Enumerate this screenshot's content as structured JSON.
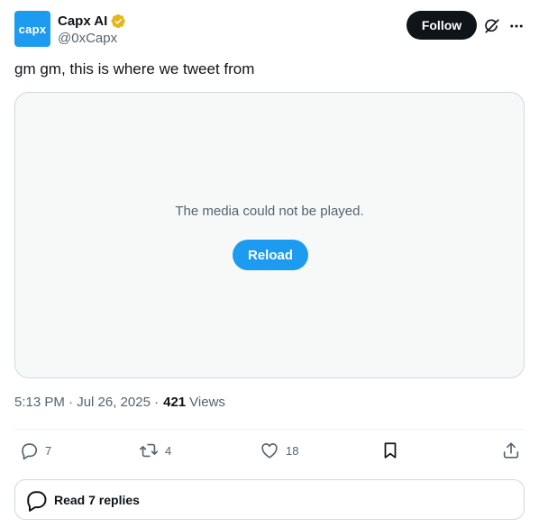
{
  "author": {
    "avatar_text": "capx",
    "display_name": "Capx AI",
    "handle": "@0xCapx",
    "verified": true,
    "brand_color": "#1d9bf0",
    "badge_color": "#e2b719"
  },
  "header": {
    "follow_label": "Follow",
    "grok_icon": "grok-icon",
    "more_icon": "more-icon"
  },
  "tweet": {
    "text": "gm gm, this is where we tweet from"
  },
  "media": {
    "message": "The media could not be played.",
    "reload_label": "Reload"
  },
  "meta": {
    "time": "5:13 PM",
    "date": "Jul 26, 2025",
    "views_count": "421",
    "views_label": "Views"
  },
  "actions": {
    "reply_count": "7",
    "retweet_count": "4",
    "like_count": "18"
  },
  "replies": {
    "label": "Read 7 replies"
  }
}
